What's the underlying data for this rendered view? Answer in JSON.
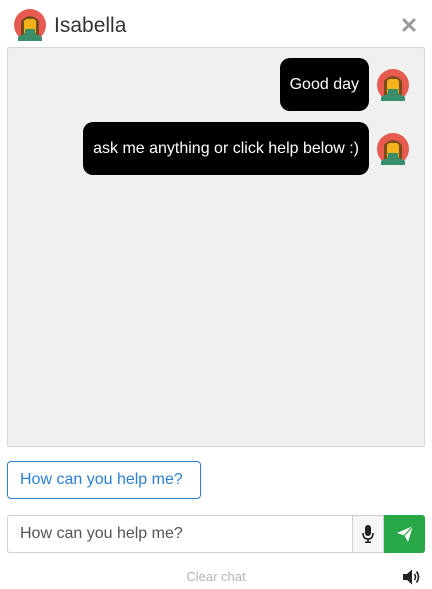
{
  "header": {
    "title": "Isabella",
    "avatar_icon": "avatar-icon",
    "close_icon": "close-icon"
  },
  "messages": [
    {
      "text": "Good day",
      "avatar_icon": "avatar-icon"
    },
    {
      "text": "ask me anything or click help below :)",
      "avatar_icon": "avatar-icon"
    }
  ],
  "quick_reply": {
    "label": "How can you help me?"
  },
  "composer": {
    "placeholder": "How can you help me?",
    "mic_icon": "microphone-icon",
    "send_icon": "paper-plane-icon"
  },
  "footer": {
    "clear_label": "Clear chat",
    "speaker_icon": "speaker-icon"
  },
  "colors": {
    "bubble": "#000000",
    "send_button": "#27a745",
    "quick_reply": "#2a7fd4",
    "chat_background": "#f0f0f0"
  }
}
